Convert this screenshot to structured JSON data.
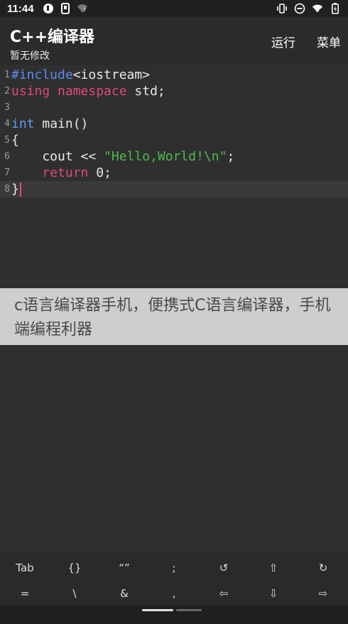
{
  "status": {
    "time": "11:44",
    "left_icons": [
      "app-notification-icon",
      "sim-card-icon",
      "wifi-question-icon"
    ],
    "right_icons": [
      "vibrate-icon",
      "do-not-disturb-icon",
      "wifi-off-icon",
      "battery-icon"
    ]
  },
  "app_bar": {
    "title": "C++编译器",
    "subtitle": "暂无修改",
    "actions": [
      "运行",
      "菜单"
    ]
  },
  "editor": {
    "line_numbers": [
      "1",
      "2",
      "3",
      "4",
      "5",
      "6",
      "7",
      "8"
    ],
    "lines": [
      [
        {
          "t": "#include",
          "c": "pre"
        },
        {
          "t": "<iostream>",
          "c": ""
        }
      ],
      [
        {
          "t": "using",
          "c": "kw"
        },
        {
          "t": " ",
          "c": ""
        },
        {
          "t": "namespace",
          "c": "kw"
        },
        {
          "t": " std;",
          "c": ""
        }
      ],
      [],
      [
        {
          "t": "int",
          "c": "type"
        },
        {
          "t": " main()",
          "c": ""
        }
      ],
      [
        {
          "t": "{",
          "c": ""
        }
      ],
      [
        {
          "t": "    cout << ",
          "c": ""
        },
        {
          "t": "\"Hello,World!\\n\"",
          "c": "str"
        },
        {
          "t": ";",
          "c": ""
        }
      ],
      [
        {
          "t": "    ",
          "c": ""
        },
        {
          "t": "return",
          "c": "kw"
        },
        {
          "t": " 0;",
          "c": ""
        }
      ],
      [
        {
          "t": "}",
          "c": ""
        }
      ]
    ],
    "current_line": 8
  },
  "overlay": {
    "text": "c语言编译器手机，便携式C语言编译器，手机端编程利器"
  },
  "keyboard": {
    "row1": [
      "Tab",
      "{}",
      "“”",
      ";",
      "↺",
      "⇧",
      "↻"
    ],
    "row2": [
      "=",
      "\\",
      "&",
      ",",
      "⇦",
      "⇩",
      "⇨"
    ]
  }
}
